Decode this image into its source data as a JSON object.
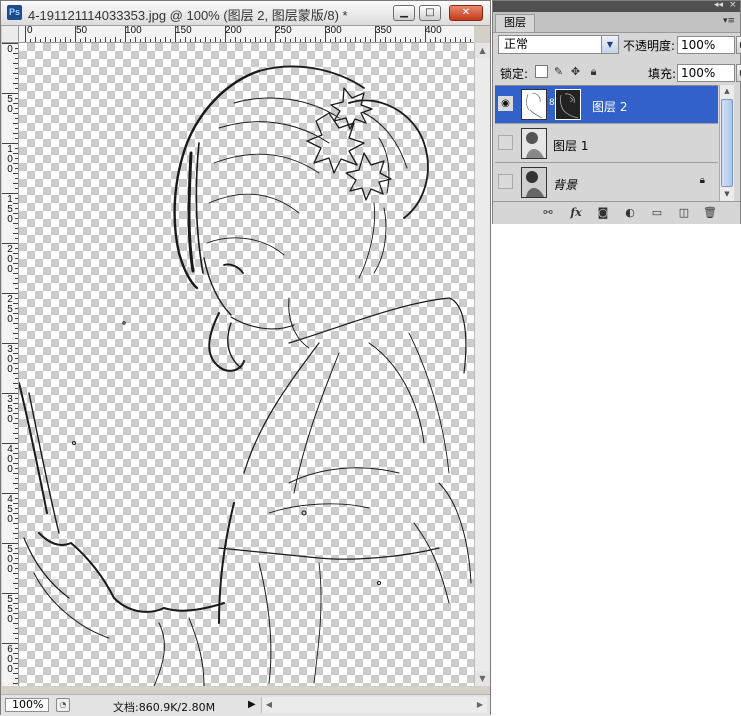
{
  "document": {
    "app_logo": "Ps",
    "title": "4-191121114033353.jpg @ 100% (图层 2, 图层蒙版/8) *",
    "zoom": "100%",
    "doc_info": "文档:860.9K/2.80M",
    "ruler_top": [
      "0",
      "50",
      "100",
      "150",
      "200",
      "250",
      "300",
      "350",
      "400"
    ],
    "ruler_left": [
      "0",
      "5 0",
      "1 0 0",
      "1 5 0",
      "2 0 0",
      "2 5 0",
      "3 0 0",
      "3 5 0",
      "4 0 0",
      "4 5 0",
      "5 0 0",
      "5 5 0",
      "6 0 0"
    ]
  },
  "layers_panel": {
    "tab": "图层",
    "blend_mode": "正常",
    "opacity_label": "不透明度:",
    "opacity_value": "100%",
    "lock_label": "锁定:",
    "fill_label": "填充:",
    "fill_value": "100%",
    "layers": [
      {
        "name": "图层 2",
        "selected": true,
        "visible": true,
        "has_mask": true
      },
      {
        "name": "图层 1",
        "selected": false,
        "visible": false,
        "has_mask": false
      },
      {
        "name": "背景",
        "selected": false,
        "visible": false,
        "locked": true
      }
    ],
    "footer_icons": [
      "link-icon",
      "fx-icon",
      "mask-icon",
      "adjustment-icon",
      "group-folder-icon",
      "new-layer-icon",
      "trash-icon"
    ]
  },
  "colors": {
    "selection": "#3262c9",
    "panel_bg": "#d6d6d6",
    "close_button": "#c4391c"
  }
}
